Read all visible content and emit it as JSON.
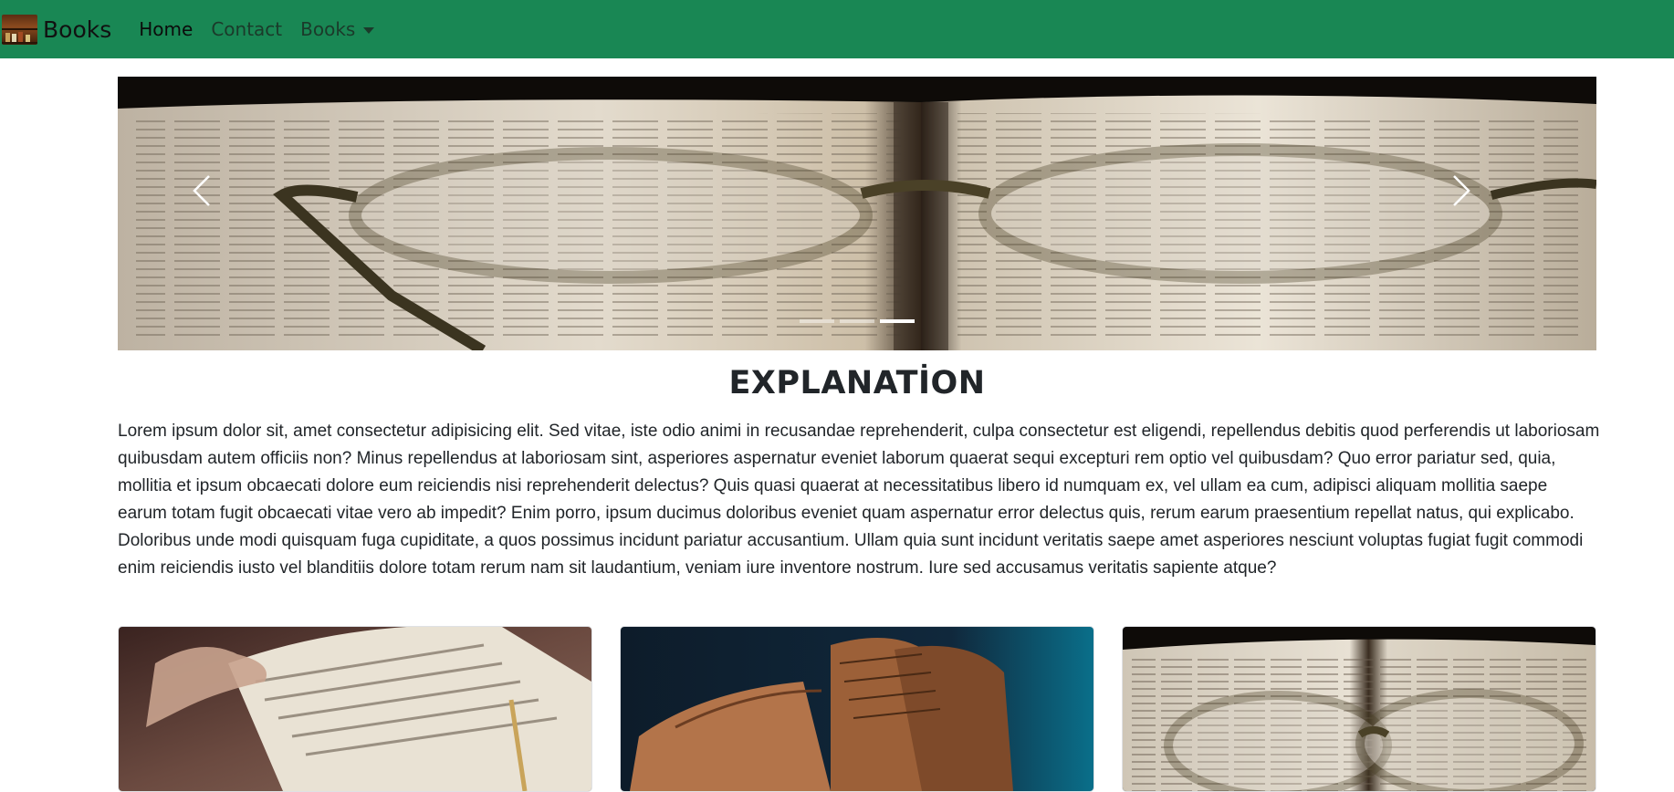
{
  "navbar": {
    "brand": "Books",
    "links": [
      {
        "label": "Home",
        "active": true
      },
      {
        "label": "Contact",
        "active": false
      },
      {
        "label": "Books",
        "active": false,
        "dropdown": true
      }
    ]
  },
  "carousel": {
    "prev_icon": "chevron-left-icon",
    "next_icon": "chevron-right-icon",
    "indicator_count": 3,
    "active_indicator": 3
  },
  "section": {
    "title": "EXPLANATİON",
    "body": "Lorem ipsum dolor sit, amet consectetur adipisicing elit. Sed vitae, iste odio animi in recusandae reprehenderit, culpa consectetur est eligendi, repellendus debitis quod perferendis ut laboriosam quibusdam autem officiis non? Minus repellendus at laboriosam sint, asperiores aspernatur eveniet laborum quaerat sequi excepturi rem optio vel quibusdam? Quo error pariatur sed, quia, mollitia et ipsum obcaecati dolore eum reiciendis nisi reprehenderit delectus? Quis quasi quaerat at necessitatibus libero id numquam ex, vel ullam ea cum, adipisci aliquam mollitia saepe earum totam fugit obcaecati vitae vero ab impedit? Enim porro, ipsum ducimus doloribus eveniet quam aspernatur error delectus quis, rerum earum praesentium repellat natus, qui explicabo. Doloribus unde modi quisquam fuga cupiditate, a quos possimus incidunt pariatur accusantium. Ullam quia sunt incidunt veritatis saepe amet asperiores nesciunt voluptas fugiat fugit commodi enim reiciendis iusto vel blanditiis dolore totam rerum nam sit laudantium, veniam iure inventore nostrum. Iure sed accusamus veritatis sapiente atque?"
  },
  "colors": {
    "navbar_bg": "#198754",
    "text": "#212529"
  }
}
